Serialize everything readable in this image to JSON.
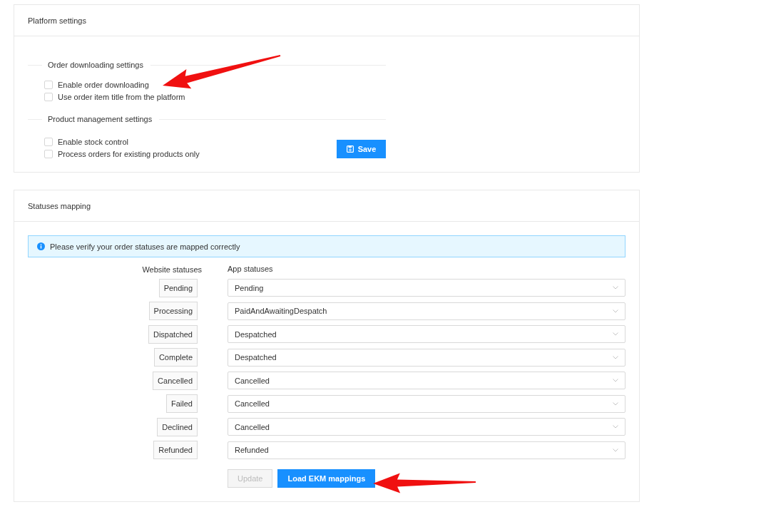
{
  "platform_settings": {
    "title": "Platform settings",
    "groups": [
      {
        "legend": "Order downloading settings",
        "options": [
          {
            "label": "Enable order downloading",
            "checked": false
          },
          {
            "label": "Use order item title from the platform",
            "checked": false
          }
        ]
      },
      {
        "legend": "Product management settings",
        "options": [
          {
            "label": "Enable stock control",
            "checked": false
          },
          {
            "label": "Process orders for existing products only",
            "checked": false
          }
        ]
      }
    ],
    "save_button": "Save"
  },
  "statuses_mapping": {
    "title": "Statuses mapping",
    "alert": "Please verify your order statuses are mapped correctly",
    "column_headers": [
      "Website statuses",
      "App statuses"
    ],
    "rows": [
      {
        "website": "Pending",
        "app": "Pending"
      },
      {
        "website": "Processing",
        "app": "PaidAndAwaitingDespatch"
      },
      {
        "website": "Dispatched",
        "app": "Despatched"
      },
      {
        "website": "Complete",
        "app": "Despatched"
      },
      {
        "website": "Cancelled",
        "app": "Cancelled"
      },
      {
        "website": "Failed",
        "app": "Cancelled"
      },
      {
        "website": "Declined",
        "app": "Cancelled"
      },
      {
        "website": "Refunded",
        "app": "Refunded"
      }
    ],
    "buttons": [
      {
        "label": "Update",
        "disabled": true
      },
      {
        "label": "Load EKM mappings",
        "disabled": false
      }
    ]
  }
}
